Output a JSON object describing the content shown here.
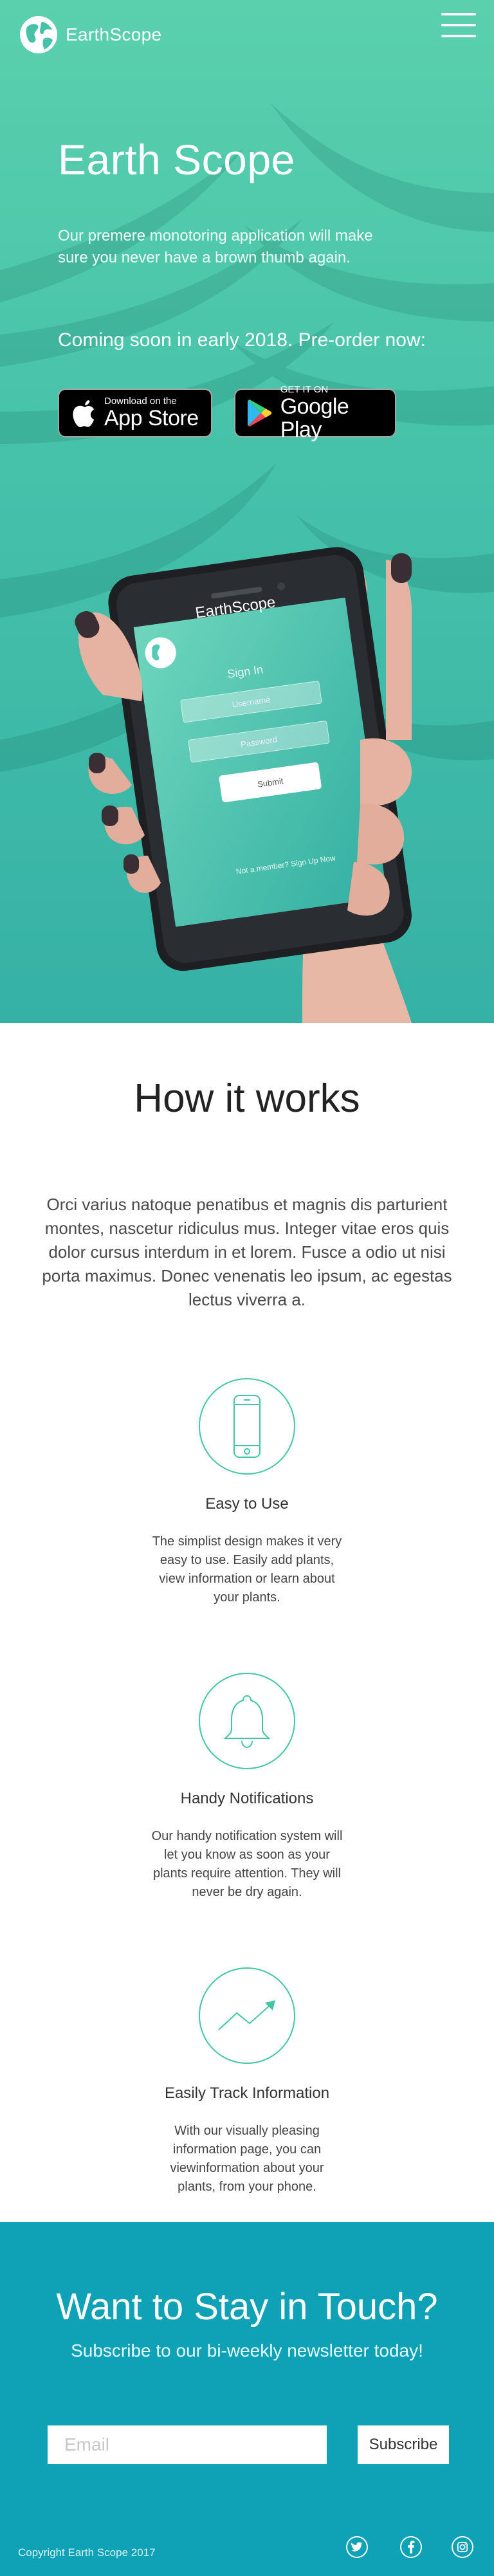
{
  "header": {
    "brand": "EarthScope",
    "logo_icon": "globe-icon",
    "menu_icon": "hamburger-menu-icon"
  },
  "hero": {
    "title": "Earth Scope",
    "description": "Our premere monotoring application will make sure you never have a brown thumb again.",
    "coming_soon": "Coming soon in early 2018. Pre-order now:",
    "app_store": {
      "small": "Download on the",
      "big": "App Store"
    },
    "google_play": {
      "small": "GET IT ON",
      "big": "Google Play"
    }
  },
  "phone_screen": {
    "brand": "EarthScope",
    "sign_in": "Sign In",
    "username_placeholder": "Username",
    "password_placeholder": "Password",
    "submit": "Submit",
    "member_prompt": "Not a member? Sign Up Now"
  },
  "how": {
    "title": "How it works",
    "description": "Orci varius natoque penatibus et magnis dis parturient montes, nascetur ridiculus mus. Integer vitae eros quis dolor cursus interdum in et lorem. Fusce a odio ut nisi porta maximus. Donec venenatis leo ipsum, ac egestas lectus viverra a.",
    "features": [
      {
        "icon": "smartphone-icon",
        "title": "Easy to Use",
        "text": "The simplist design makes it very easy to use. Easily add plants, view information or learn about your plants."
      },
      {
        "icon": "bell-icon",
        "title": "Handy Notifications",
        "text": "Our handy notification system will let you know as soon as your plants require attention. They will never be dry again."
      },
      {
        "icon": "trend-arrow-icon",
        "title": "Easily Track Information",
        "text": "With our visually pleasing information page, you can viewinformation about your plants, from your phone."
      }
    ]
  },
  "newsletter": {
    "title": "Want to Stay in Touch?",
    "subtitle": "Subscribe to our bi-weekly newsletter today!",
    "email_placeholder": "Email",
    "subscribe": "Subscribe",
    "copyright": "Copyright Earth Scope 2017",
    "social": [
      "twitter-icon",
      "facebook-icon",
      "instagram-icon"
    ]
  },
  "colors": {
    "hero_top": "#5ad0ad",
    "hero_bottom": "#36b1a6",
    "accent": "#41c6a6",
    "newsletter_bg": "#0fa1b5"
  }
}
